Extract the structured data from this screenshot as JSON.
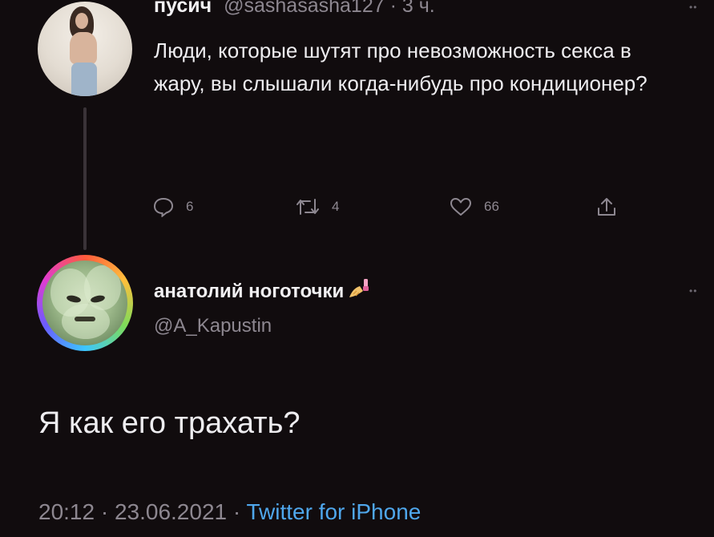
{
  "tweet1": {
    "display_name": "пусич",
    "handle": "@sashasasha127",
    "separator": " · ",
    "time": "3 ч.",
    "text": "Люди, которые шутят про невозможность секса в жару, вы слышали когда-нибудь про кондиционер?",
    "actions": {
      "reply_count": "6",
      "retweet_count": "4",
      "like_count": "66"
    }
  },
  "tweet2": {
    "display_name": "анатолий ноготочки",
    "handle": "@A_Kapustin",
    "text": "Я как его трахать?",
    "date_time": "20:12 · 23.06.2021 · ",
    "client": "Twitter for iPhone"
  },
  "icons": {
    "reply": "speech-bubble-icon",
    "retweet": "retweet-arrows-icon",
    "like": "heart-icon",
    "share": "share-upload-icon",
    "more": "more-dots-icon",
    "emoji": "nail-polish-emoji"
  },
  "colors": {
    "background": "#110c0e",
    "text": "#eeedf0",
    "muted": "#8d8790",
    "link": "#4fa7ec"
  }
}
